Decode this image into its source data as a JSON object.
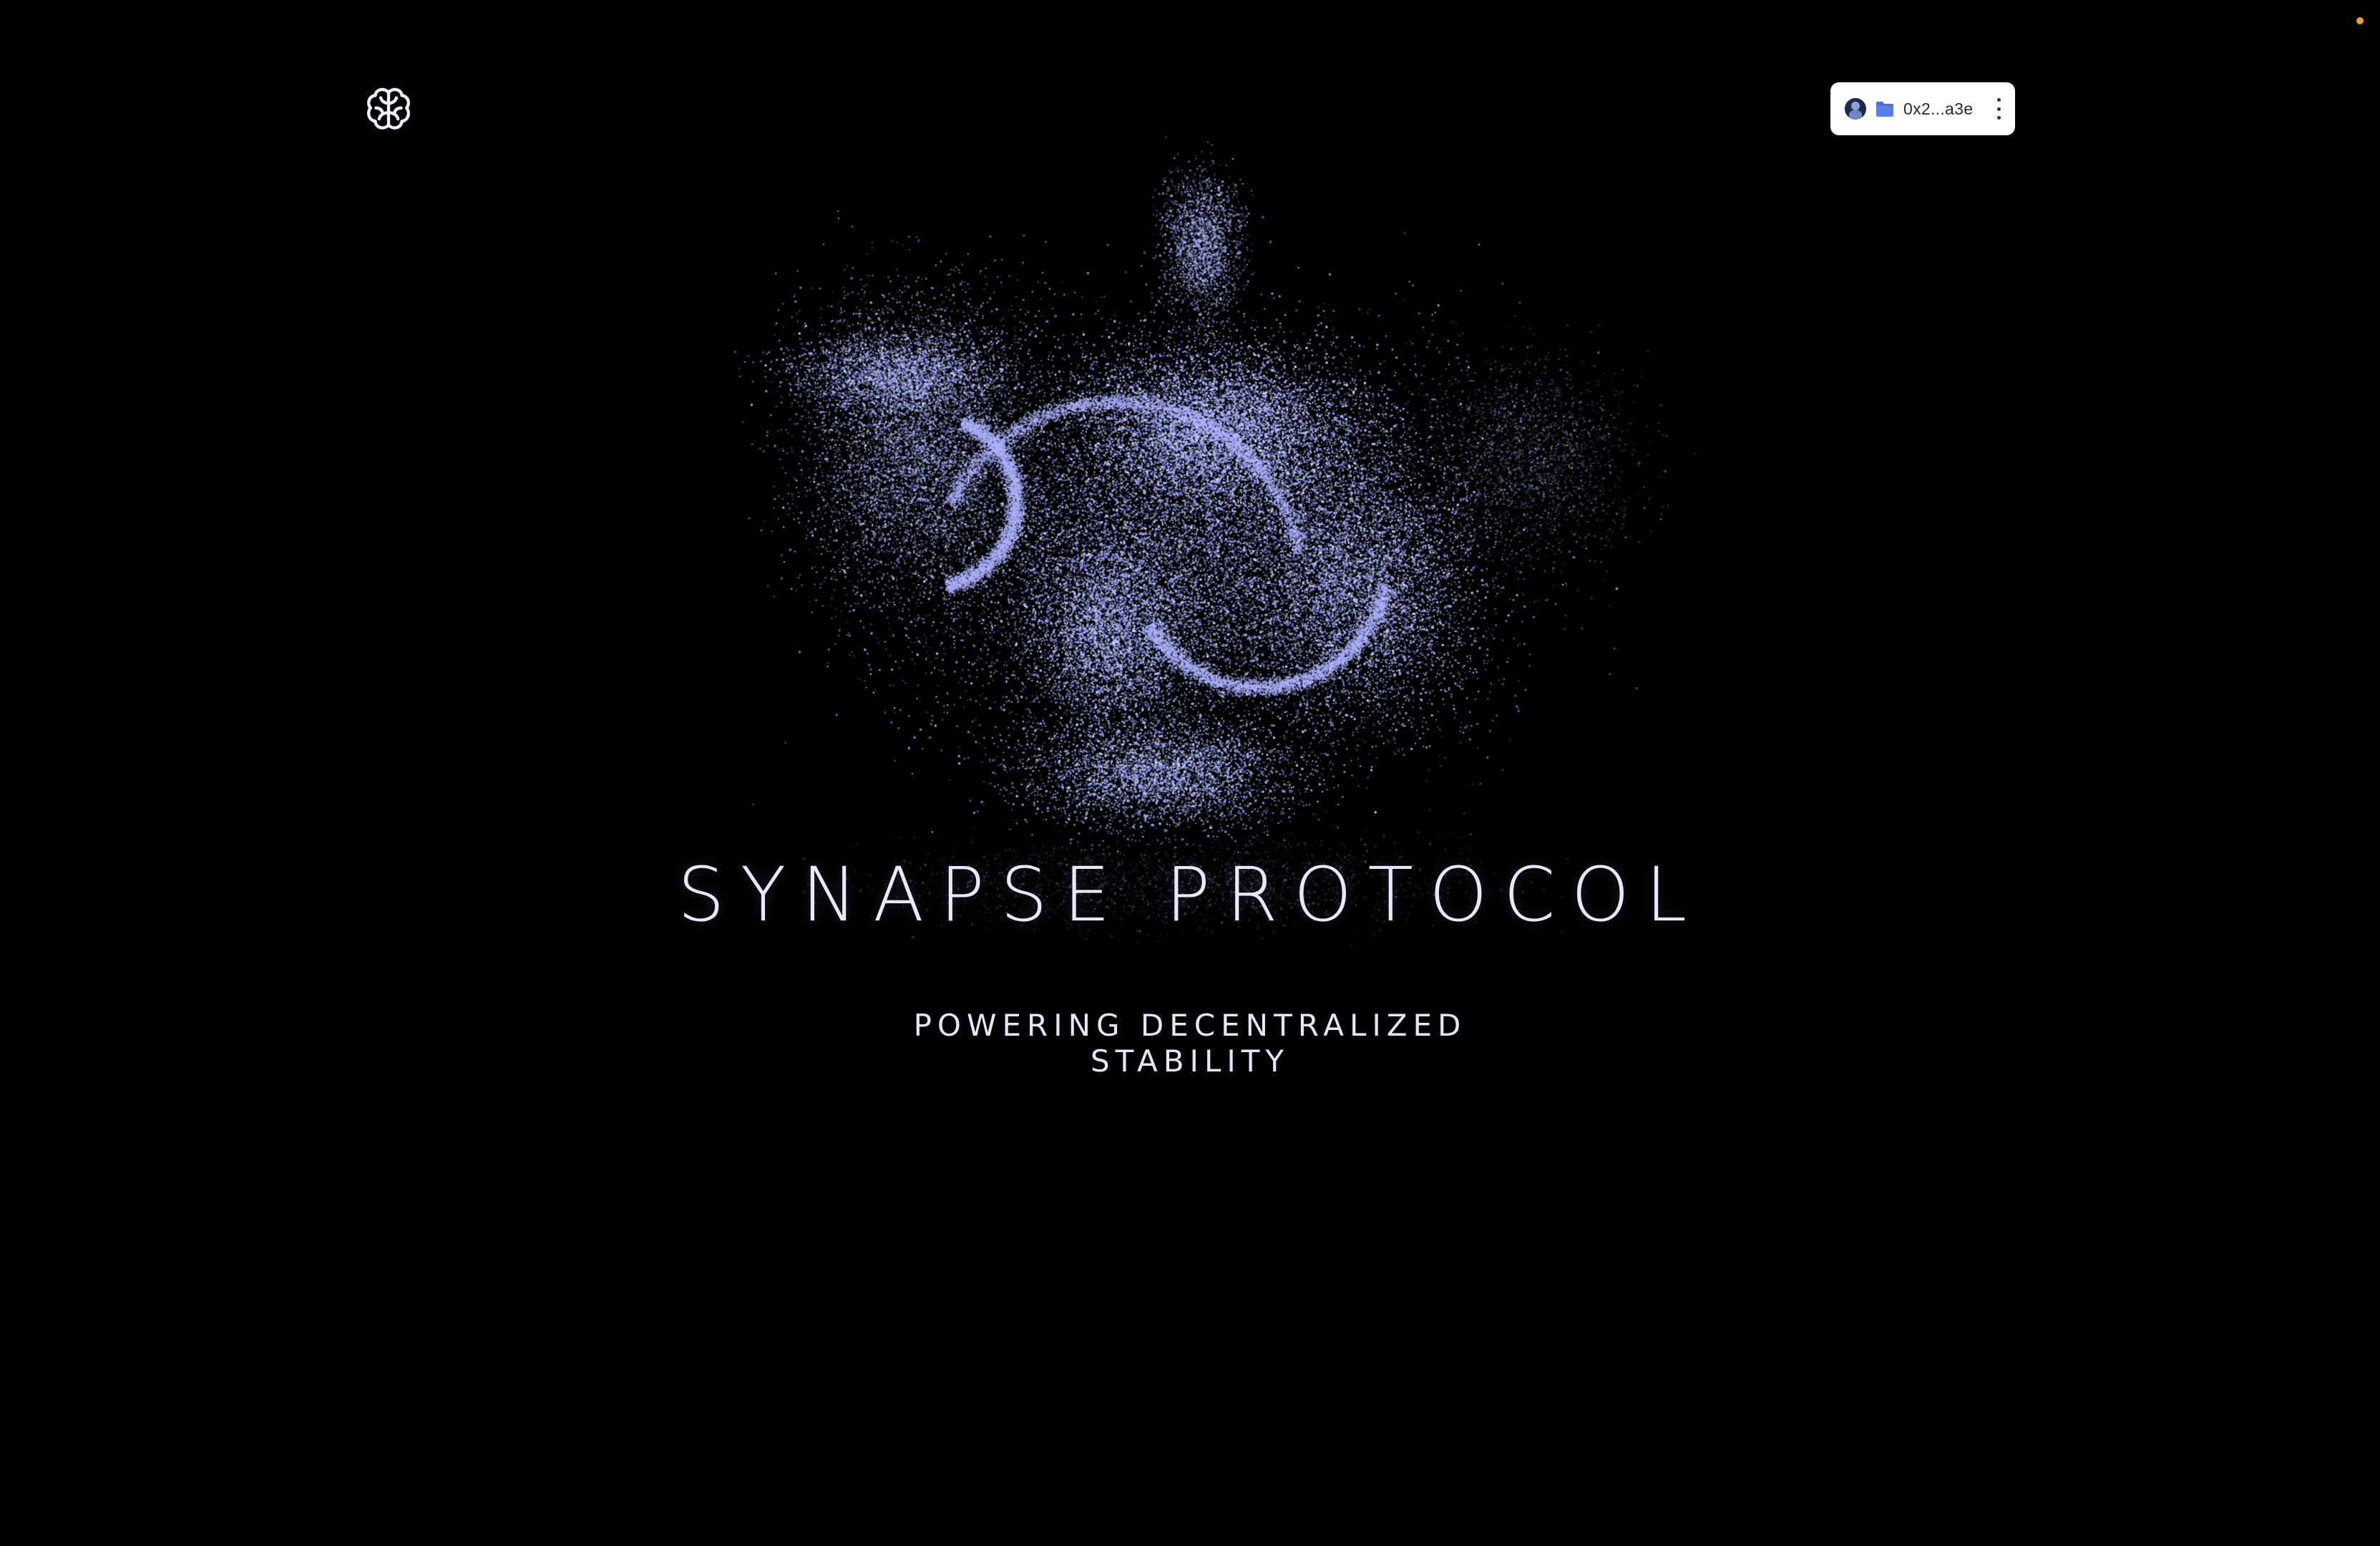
{
  "header": {
    "logo_icon": "brain-icon",
    "wallet": {
      "avatar_icon": "user-avatar-icon",
      "wallet_icon": "folder-wallet-icon",
      "address": "0x2...a3e",
      "menu_icon": "kebab-menu-icon"
    }
  },
  "hero": {
    "title": "SYNAPSE PROTOCOL",
    "subtitle": "POWERING DECENTRALIZED STABILITY",
    "particle_color": "#9aa0ff"
  },
  "colors": {
    "background": "#000000",
    "text": "#e8e8f8",
    "wallet_accent": "#4a6ee8",
    "status_dot": "#f0a020"
  }
}
